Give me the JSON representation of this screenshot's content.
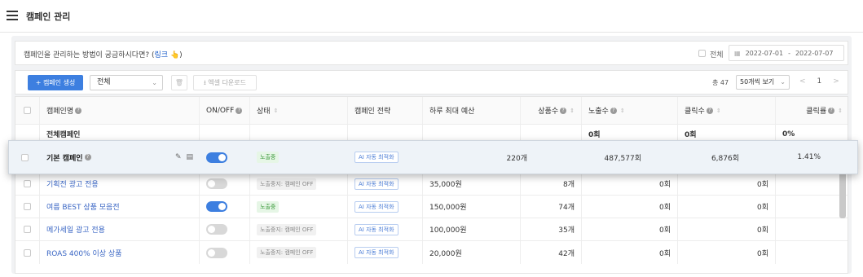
{
  "page_title": "캠페인 관리",
  "notice": {
    "text": "캠페인을 관리하는 방법이 궁금하시다면? (",
    "link": "링크",
    "hand": "👆",
    "close": ")",
    "all_label": "전체",
    "date_start": "2022-07-01",
    "date_sep": "-",
    "date_end": "2022-07-07"
  },
  "toolbar": {
    "new_label": "+ 캠페인 생성",
    "filter_value": "전체",
    "trash_label": "🗑",
    "excel_label": "⭳ 엑셀 다운로드",
    "total": "총 47",
    "page_size": "50개씩 보기",
    "prev": "<",
    "page": "1",
    "next": ">"
  },
  "columns": [
    "캠페인명",
    "ON/OFF",
    "상태",
    "캠페인 전략",
    "하루 최대 예산",
    "상품수",
    "노출수",
    "클릭수",
    "클릭률"
  ],
  "summary": {
    "label": "전체캠페인",
    "impressions": "0회",
    "clicks": "0회",
    "ctr": "0%"
  },
  "highlight_row": {
    "name": "기본 캠페인",
    "on": true,
    "status": "노출중",
    "strategy": "AI 자동 최적화",
    "products": "220개",
    "impressions": "487,577회",
    "clicks": "6,876회",
    "ctr": "1.41%"
  },
  "rows": [
    {
      "name": "기획전 광고 전용",
      "on": false,
      "status": "노출중지: 캠페인 OFF",
      "strategy": "AI 자동 최적화",
      "budget": "35,000원",
      "products": "8개",
      "impressions": "0회",
      "clicks": "0회"
    },
    {
      "name": "여름 BEST 상품 모음전",
      "on": true,
      "status": "노출중",
      "strategy": "AI 자동 최적화",
      "budget": "150,000원",
      "products": "74개",
      "impressions": "0회",
      "clicks": "0회"
    },
    {
      "name": "메가세일 광고 전용",
      "on": false,
      "status": "노출중지: 캠페인 OFF",
      "strategy": "AI 자동 최적화",
      "budget": "100,000원",
      "products": "35개",
      "impressions": "0회",
      "clicks": "0회"
    },
    {
      "name": "ROAS 400% 이상 상품",
      "on": false,
      "status": "노출중지: 캠페인 OFF",
      "strategy": "AI 자동 최적화",
      "budget": "20,000원",
      "products": "42개",
      "impressions": "0회",
      "clicks": "0회"
    }
  ]
}
